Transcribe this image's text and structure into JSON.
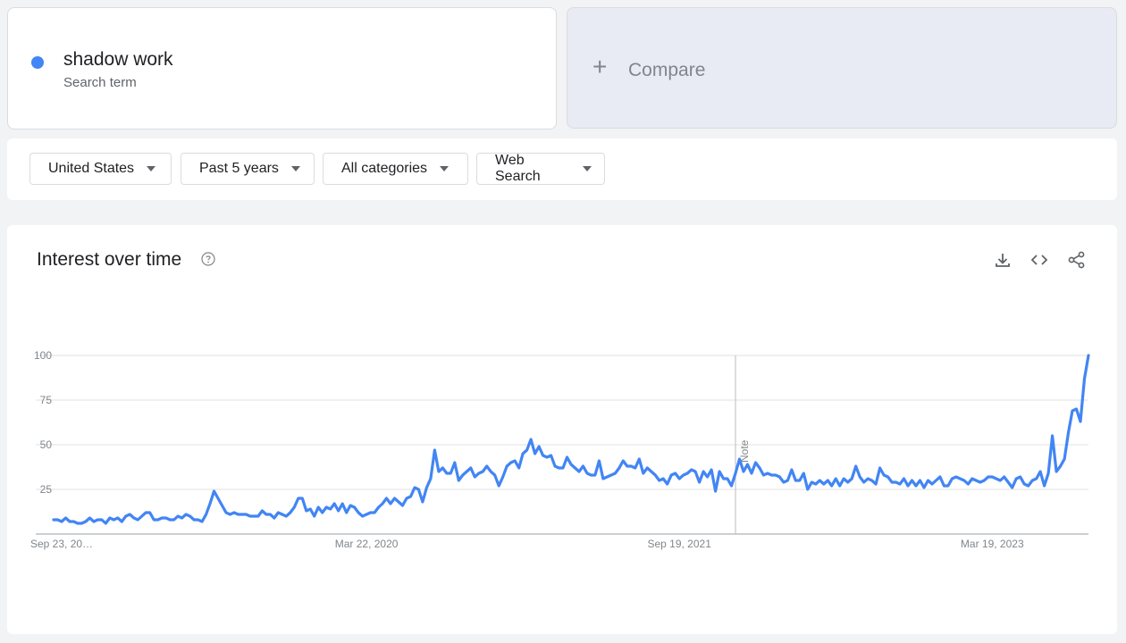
{
  "term": {
    "name": "shadow work",
    "subtitle": "Search term",
    "color": "#4285f4"
  },
  "compare": {
    "label": "Compare",
    "icon": "plus-icon"
  },
  "filters": [
    {
      "label": "United States"
    },
    {
      "label": "Past 5 years"
    },
    {
      "label": "All categories"
    },
    {
      "label": "Web Search"
    }
  ],
  "chart": {
    "title": "Interest over time",
    "icons": [
      "help-icon",
      "download-icon",
      "embed-code-icon",
      "share-icon"
    ],
    "note_label": "Note"
  },
  "chart_data": {
    "type": "line",
    "xlabel": "",
    "ylabel": "",
    "ylim": [
      0,
      100
    ],
    "yticks": [
      25,
      50,
      75,
      100
    ],
    "x_tick_labels": [
      "Sep 23, 20…",
      "Mar 22, 2020",
      "Sep 19, 2021",
      "Mar 19, 2023"
    ],
    "x_tick_index": [
      0,
      78,
      156,
      234
    ],
    "note_index": 170,
    "grid": true,
    "series": [
      {
        "color": "#4285f4",
        "values": [
          8,
          8,
          7,
          9,
          7,
          7,
          6,
          6,
          7,
          9,
          7,
          8,
          8,
          6,
          9,
          8,
          9,
          7,
          10,
          11,
          9,
          8,
          10,
          12,
          12,
          8,
          8,
          9,
          9,
          8,
          8,
          10,
          9,
          11,
          10,
          8,
          8,
          7,
          11,
          17,
          24,
          20,
          16,
          12,
          11,
          12,
          11,
          11,
          11,
          10,
          10,
          10,
          13,
          11,
          11,
          9,
          12,
          11,
          10,
          12,
          15,
          20,
          20,
          13,
          14,
          10,
          15,
          12,
          15,
          14,
          17,
          13,
          17,
          12,
          16,
          15,
          12,
          10,
          11,
          12,
          12,
          15,
          17,
          20,
          17,
          20,
          18,
          16,
          20,
          21,
          26,
          25,
          18,
          26,
          31,
          47,
          35,
          37,
          34,
          34,
          40,
          30,
          33,
          35,
          37,
          32,
          34,
          35,
          38,
          35,
          33,
          27,
          32,
          38,
          40,
          41,
          37,
          45,
          47,
          53,
          45,
          49,
          44,
          43,
          44,
          38,
          37,
          37,
          43,
          39,
          37,
          35,
          38,
          34,
          33,
          33,
          41,
          31,
          32,
          33,
          34,
          37,
          41,
          38,
          38,
          37,
          42,
          34,
          37,
          35,
          33,
          30,
          31,
          28,
          33,
          34,
          31,
          33,
          34,
          36,
          35,
          29,
          35,
          32,
          36,
          24,
          35,
          31,
          31,
          27,
          34,
          42,
          35,
          39,
          34,
          40,
          37,
          33,
          34,
          33,
          33,
          32,
          29,
          30,
          36,
          30,
          30,
          34,
          25,
          29,
          28,
          30,
          28,
          30,
          27,
          31,
          27,
          31,
          29,
          31,
          38,
          32,
          29,
          31,
          30,
          28,
          37,
          33,
          32,
          29,
          29,
          28,
          31,
          27,
          30,
          27,
          30,
          26,
          30,
          28,
          30,
          32,
          27,
          27,
          31,
          32,
          31,
          30,
          28,
          31,
          30,
          29,
          30,
          32,
          32,
          31,
          30,
          32,
          29,
          26,
          31,
          32,
          28,
          27,
          30,
          31,
          35,
          27,
          34,
          55,
          35,
          38,
          42,
          57,
          69,
          70,
          63,
          87,
          100
        ]
      }
    ]
  }
}
